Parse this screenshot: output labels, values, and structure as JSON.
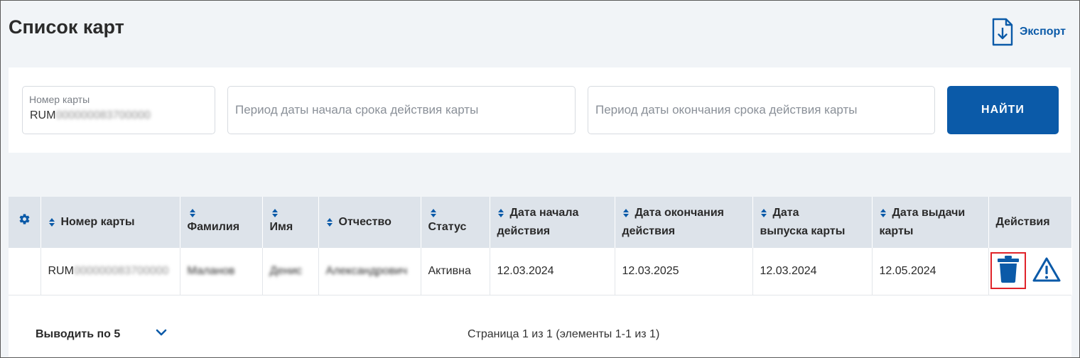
{
  "page": {
    "title": "Список карт"
  },
  "toolbar": {
    "export_label": "Экспорт"
  },
  "filters": {
    "card_number": {
      "label": "Номер карты",
      "value_prefix": "RUM",
      "value_masked": "000000083700000"
    },
    "period_start": {
      "placeholder": "Период даты начала срока действия карты"
    },
    "period_end": {
      "placeholder": "Период даты окончания срока действия карты"
    },
    "search_label": "НАЙТИ"
  },
  "table": {
    "headers": {
      "card_number": "Номер карты",
      "last_name": "Фамилия",
      "first_name": "Имя",
      "patronymic": "Отчество",
      "status": "Статус",
      "start_date": [
        "Дата начала",
        "действия"
      ],
      "end_date": [
        "Дата окончания",
        "действия"
      ],
      "issue_date": [
        "Дата",
        "выпуска карты"
      ],
      "delivery_date": [
        "Дата выдачи",
        "карты"
      ],
      "actions": "Действия"
    },
    "rows": [
      {
        "card_prefix": "RUM",
        "card_masked": "000000083700000",
        "last_name": "Маланов",
        "first_name": "Денис",
        "patronymic": "Александрович",
        "status": "Активна",
        "start_date": "12.03.2024",
        "end_date": "12.03.2025",
        "issue_date": "12.03.2024",
        "delivery_date": "12.05.2024"
      }
    ]
  },
  "pagination": {
    "page_size_label": "Выводить по 5",
    "info": "Страница 1 из 1 (элементы 1-1 из 1)"
  },
  "colors": {
    "accent": "#0b5aa8",
    "highlight": "#e0232a",
    "header_bg": "#dde3ea",
    "page_bg": "#f1f4f7"
  },
  "icons": {
    "export": "file-download-icon",
    "settings": "gear-icon",
    "sort": "sort-icon",
    "delete": "trash-icon",
    "warning": "warning-triangle-icon",
    "page_size": "chevron-down-icon"
  }
}
